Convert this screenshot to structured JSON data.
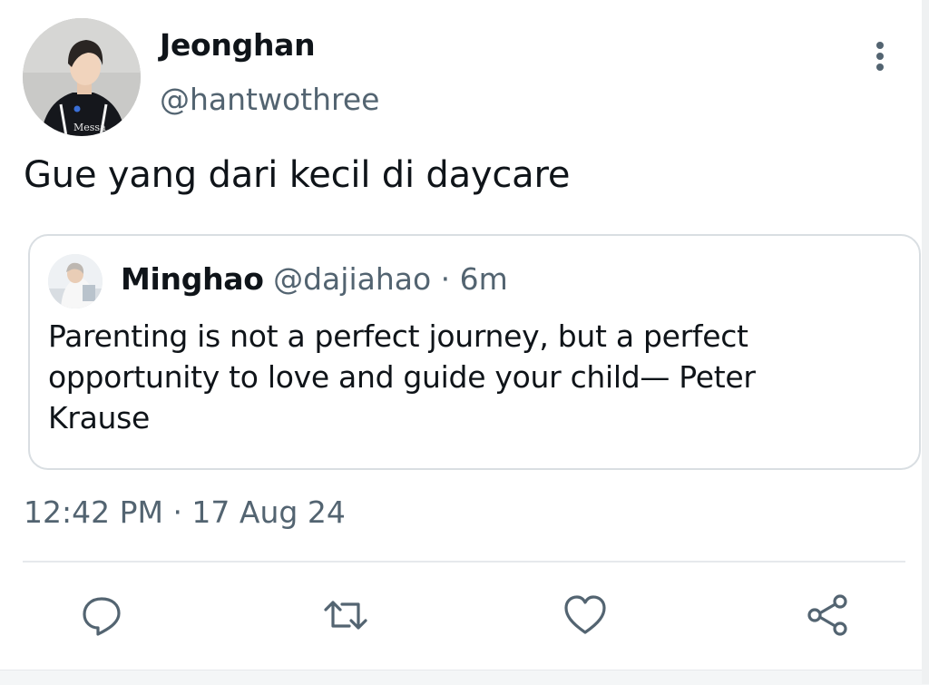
{
  "tweet": {
    "author": {
      "display_name": "Jeonghan",
      "handle": "@hantwothree",
      "avatar_icon": "profile-photo"
    },
    "text": "Gue yang dari kecil di daycare",
    "quoted_tweet": {
      "display_name": "Minghao",
      "handle": "@dajiahao",
      "separator": "·",
      "relative_time": "6m",
      "text": "Parenting is not a perfect journey, but a perfect opportunity to love and guide your child— Peter Krause"
    },
    "timestamp": "12:42 PM · 17 Aug 24"
  },
  "actions": {
    "reply_icon": "reply-icon",
    "retweet_icon": "retweet-icon",
    "like_icon": "heart-icon",
    "share_icon": "share-icon",
    "more_icon": "more-vertical-icon"
  },
  "colors": {
    "primary_text": "#0f1419",
    "secondary_text": "#536471",
    "icon": "#536471",
    "border": "#d9dee2"
  }
}
